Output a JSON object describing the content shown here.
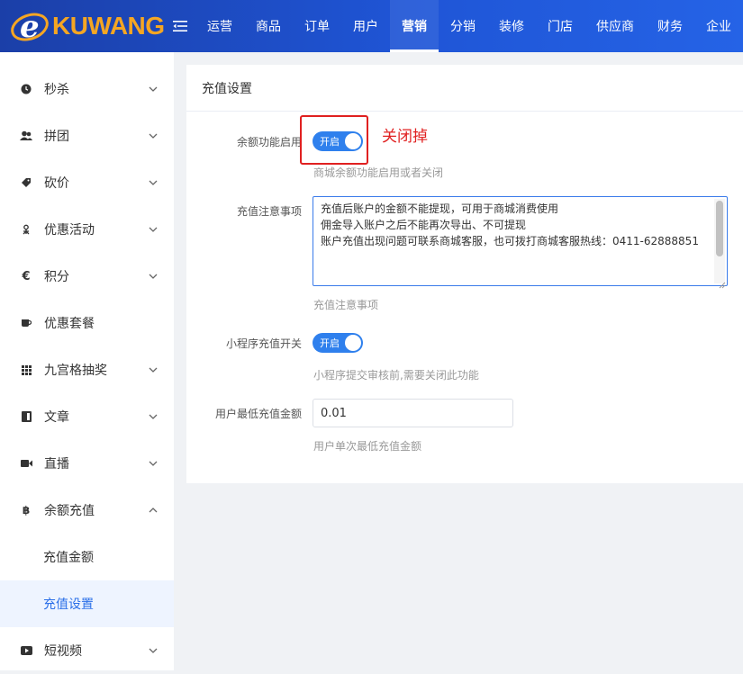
{
  "header": {
    "logo_text": "KUWANG",
    "brand_color": "#f5a623",
    "menu_icon": "menu-fold-icon",
    "nav": [
      "运营",
      "商品",
      "订单",
      "用户",
      "营销",
      "分销",
      "装修",
      "门店",
      "供应商",
      "财务",
      "企业"
    ],
    "active_nav": "营销"
  },
  "sidebar": {
    "items": [
      {
        "label": "秒杀",
        "icon": "clock-icon"
      },
      {
        "label": "拼团",
        "icon": "group-icon"
      },
      {
        "label": "砍价",
        "icon": "tag-icon"
      },
      {
        "label": "优惠活动",
        "icon": "gift-icon"
      },
      {
        "label": "积分",
        "icon": "euro-icon"
      },
      {
        "label": "优惠套餐",
        "icon": "cup-icon"
      },
      {
        "label": "九宫格抽奖",
        "icon": "grid-icon"
      },
      {
        "label": "文章",
        "icon": "article-icon"
      },
      {
        "label": "直播",
        "icon": "video-icon"
      },
      {
        "label": "余额充值",
        "icon": "bitcoin-icon"
      }
    ],
    "sub_items": [
      "充值金额",
      "充值设置"
    ],
    "active_sub": "充值设置",
    "last_item": {
      "label": "短视频",
      "icon": "youtube-icon"
    }
  },
  "main": {
    "title": "充值设置",
    "balance_switch": {
      "label": "余额功能启用",
      "state_text": "开启",
      "help": "商城余额功能启用或者关闭"
    },
    "notice": {
      "label": "充值注意事项",
      "lines": [
        "充值后账户的金额不能提现，可用于商城消费使用",
        "佣金导入账户之后不能再次导出、不可提现",
        "账户充值出现问题可联系商城客服，也可拨打商城客服热线：0411-62888851"
      ],
      "help": "充值注意事项"
    },
    "mini_switch": {
      "label": "小程序充值开关",
      "state_text": "开启",
      "help": "小程序提交审核前,需要关闭此功能"
    },
    "min_amount": {
      "label": "用户最低充值金额",
      "value": "0.01",
      "help": "用户单次最低充值金额"
    }
  },
  "annotation": {
    "text": "关闭掉",
    "color": "#e02020"
  },
  "colors": {
    "accent": "#2f80ed",
    "active_bg": "#eef4ff"
  }
}
